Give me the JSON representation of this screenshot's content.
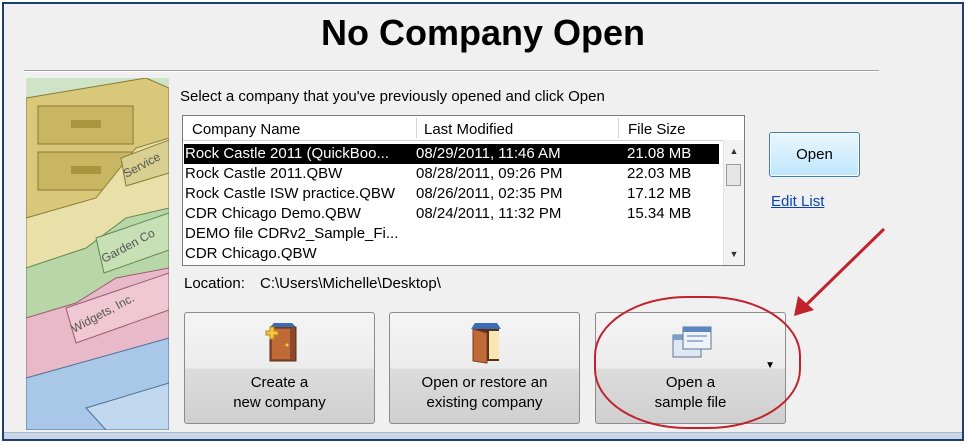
{
  "title": "No Company Open",
  "prompt": "Select a company that you've previously opened and click Open",
  "illustration": {
    "folder_labels": [
      "Service",
      "Garden Co",
      "Widgets, Inc."
    ]
  },
  "company_list": {
    "columns": [
      "Company Name",
      "Last Modified",
      "File Size"
    ],
    "rows": [
      {
        "name": "Rock Castle 2011 (QuickBoo...",
        "modified": "08/29/2011, 11:46 AM",
        "size": "21.08 MB"
      },
      {
        "name": "Rock Castle 2011.QBW",
        "modified": "08/28/2011, 09:26 PM",
        "size": "22.03 MB"
      },
      {
        "name": "Rock Castle ISW practice.QBW",
        "modified": "08/26/2011, 02:35 PM",
        "size": "17.12 MB"
      },
      {
        "name": "CDR Chicago Demo.QBW",
        "modified": "08/24/2011, 11:32 PM",
        "size": "15.34 MB"
      },
      {
        "name": "DEMO file CDRv2_Sample_Fi...",
        "modified": "",
        "size": ""
      },
      {
        "name": "CDR Chicago.QBW",
        "modified": "",
        "size": ""
      }
    ],
    "selected_row": 0
  },
  "location": {
    "label": "Location:",
    "value": "C:\\Users\\Michelle\\Desktop\\"
  },
  "open_button": "Open",
  "edit_list_link": "Edit List",
  "buttons": {
    "create": {
      "line1": "Create a",
      "line2": "new company"
    },
    "restore": {
      "line1": "Open or restore an",
      "line2": "existing company"
    },
    "sample": {
      "line1": "Open a",
      "line2": "sample file"
    }
  },
  "colors": {
    "annotation_red": "#c0232c",
    "link_blue": "#0645ad",
    "selection": "#000000"
  },
  "icons": {
    "create": "new-company-door-icon",
    "restore": "open-door-icon",
    "sample": "sample-file-windows-icon",
    "sample_dropdown": "caret-down-icon"
  }
}
